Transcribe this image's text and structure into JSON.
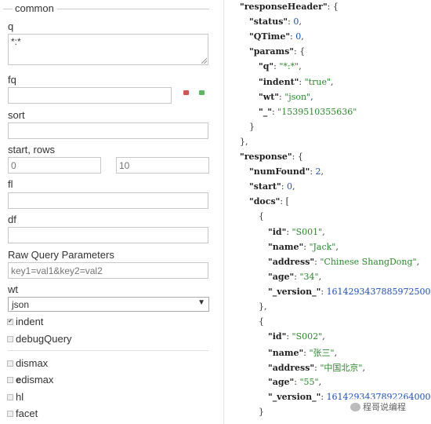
{
  "form": {
    "legend": "common",
    "q_label": "q",
    "q_value": "*:*",
    "fq_label": "fq",
    "sort_label": "sort",
    "start_rows_label": "start, rows",
    "start_placeholder": "0",
    "rows_placeholder": "10",
    "fl_label": "fl",
    "df_label": "df",
    "raw_label": "Raw Query Parameters",
    "raw_placeholder": "key1=val1&key2=val2",
    "wt_label": "wt",
    "wt_value": "json",
    "indent_label": "indent",
    "indent_checked": true,
    "debug_label": "debugQuery",
    "dismax_label": "dismax",
    "edismax_prefix": "e",
    "edismax_rest": "dismax",
    "hl_label": "hl",
    "facet_label": "facet",
    "check_mark": "✔",
    "remove_color": "#d9534f",
    "add_color": "#5cb85c"
  },
  "response": {
    "lines": [
      {
        "indent": 0,
        "parts": [
          {
            "t": "k",
            "v": "\"responseHeader\""
          },
          {
            "t": "p",
            "v": ": {"
          }
        ]
      },
      {
        "indent": 1,
        "parts": [
          {
            "t": "k",
            "v": "\"status\""
          },
          {
            "t": "p",
            "v": ": "
          },
          {
            "t": "n",
            "v": "0"
          },
          {
            "t": "p",
            "v": ","
          }
        ]
      },
      {
        "indent": 1,
        "parts": [
          {
            "t": "k",
            "v": "\"QTime\""
          },
          {
            "t": "p",
            "v": ": "
          },
          {
            "t": "n",
            "v": "0"
          },
          {
            "t": "p",
            "v": ","
          }
        ]
      },
      {
        "indent": 1,
        "parts": [
          {
            "t": "k",
            "v": "\"params\""
          },
          {
            "t": "p",
            "v": ": {"
          }
        ]
      },
      {
        "indent": 2,
        "parts": [
          {
            "t": "k",
            "v": "\"q\""
          },
          {
            "t": "p",
            "v": ": "
          },
          {
            "t": "s",
            "v": "\"*:*\""
          },
          {
            "t": "p",
            "v": ","
          }
        ]
      },
      {
        "indent": 2,
        "parts": [
          {
            "t": "k",
            "v": "\"indent\""
          },
          {
            "t": "p",
            "v": ": "
          },
          {
            "t": "s",
            "v": "\"true\""
          },
          {
            "t": "p",
            "v": ","
          }
        ]
      },
      {
        "indent": 2,
        "parts": [
          {
            "t": "k",
            "v": "\"wt\""
          },
          {
            "t": "p",
            "v": ": "
          },
          {
            "t": "s",
            "v": "\"json\""
          },
          {
            "t": "p",
            "v": ","
          }
        ]
      },
      {
        "indent": 2,
        "parts": [
          {
            "t": "k",
            "v": "\"_\""
          },
          {
            "t": "p",
            "v": ": "
          },
          {
            "t": "s",
            "v": "\"1539510355636\""
          }
        ]
      },
      {
        "indent": 1,
        "parts": [
          {
            "t": "p",
            "v": "}"
          }
        ]
      },
      {
        "indent": 0,
        "parts": [
          {
            "t": "p",
            "v": "},"
          }
        ]
      },
      {
        "indent": 0,
        "parts": [
          {
            "t": "k",
            "v": "\"response\""
          },
          {
            "t": "p",
            "v": ": {"
          }
        ]
      },
      {
        "indent": 1,
        "parts": [
          {
            "t": "k",
            "v": "\"numFound\""
          },
          {
            "t": "p",
            "v": ": "
          },
          {
            "t": "n",
            "v": "2"
          },
          {
            "t": "p",
            "v": ","
          }
        ]
      },
      {
        "indent": 1,
        "parts": [
          {
            "t": "k",
            "v": "\"start\""
          },
          {
            "t": "p",
            "v": ": "
          },
          {
            "t": "n",
            "v": "0"
          },
          {
            "t": "p",
            "v": ","
          }
        ]
      },
      {
        "indent": 1,
        "parts": [
          {
            "t": "k",
            "v": "\"docs\""
          },
          {
            "t": "p",
            "v": ": ["
          }
        ]
      },
      {
        "indent": 2,
        "parts": [
          {
            "t": "p",
            "v": "{"
          }
        ]
      },
      {
        "indent": 3,
        "parts": [
          {
            "t": "k",
            "v": "\"id\""
          },
          {
            "t": "p",
            "v": ": "
          },
          {
            "t": "s",
            "v": "\"S001\""
          },
          {
            "t": "p",
            "v": ","
          }
        ]
      },
      {
        "indent": 3,
        "parts": [
          {
            "t": "k",
            "v": "\"name\""
          },
          {
            "t": "p",
            "v": ": "
          },
          {
            "t": "s",
            "v": "\"Jack\""
          },
          {
            "t": "p",
            "v": ","
          }
        ]
      },
      {
        "indent": 3,
        "parts": [
          {
            "t": "k",
            "v": "\"address\""
          },
          {
            "t": "p",
            "v": ": "
          },
          {
            "t": "s",
            "v": "\"Chinese ShangDong\""
          },
          {
            "t": "p",
            "v": ","
          }
        ]
      },
      {
        "indent": 3,
        "parts": [
          {
            "t": "k",
            "v": "\"age\""
          },
          {
            "t": "p",
            "v": ": "
          },
          {
            "t": "s",
            "v": "\"34\""
          },
          {
            "t": "p",
            "v": ","
          }
        ]
      },
      {
        "indent": 3,
        "parts": [
          {
            "t": "k",
            "v": "\"_version_\""
          },
          {
            "t": "p",
            "v": ": "
          },
          {
            "t": "n",
            "v": "1614293437885972500"
          }
        ]
      },
      {
        "indent": 2,
        "parts": [
          {
            "t": "p",
            "v": "},"
          }
        ]
      },
      {
        "indent": 2,
        "parts": [
          {
            "t": "p",
            "v": "{"
          }
        ]
      },
      {
        "indent": 3,
        "parts": [
          {
            "t": "k",
            "v": "\"id\""
          },
          {
            "t": "p",
            "v": ": "
          },
          {
            "t": "s",
            "v": "\"S002\""
          },
          {
            "t": "p",
            "v": ","
          }
        ]
      },
      {
        "indent": 3,
        "parts": [
          {
            "t": "k",
            "v": "\"name\""
          },
          {
            "t": "p",
            "v": ": "
          },
          {
            "t": "s",
            "v": "\"张三\""
          },
          {
            "t": "p",
            "v": ","
          }
        ]
      },
      {
        "indent": 3,
        "parts": [
          {
            "t": "k",
            "v": "\"address\""
          },
          {
            "t": "p",
            "v": ": "
          },
          {
            "t": "s",
            "v": "\"中国北京\""
          },
          {
            "t": "p",
            "v": ","
          }
        ]
      },
      {
        "indent": 3,
        "parts": [
          {
            "t": "k",
            "v": "\"age\""
          },
          {
            "t": "p",
            "v": ": "
          },
          {
            "t": "s",
            "v": "\"55\""
          },
          {
            "t": "p",
            "v": ","
          }
        ]
      },
      {
        "indent": 3,
        "parts": [
          {
            "t": "k",
            "v": "\"_version_\""
          },
          {
            "t": "p",
            "v": ": "
          },
          {
            "t": "n",
            "v": "1614293437892264000"
          }
        ]
      },
      {
        "indent": 2,
        "parts": [
          {
            "t": "p",
            "v": "}"
          }
        ]
      }
    ]
  },
  "watermark": {
    "text": "程哥说编程"
  }
}
